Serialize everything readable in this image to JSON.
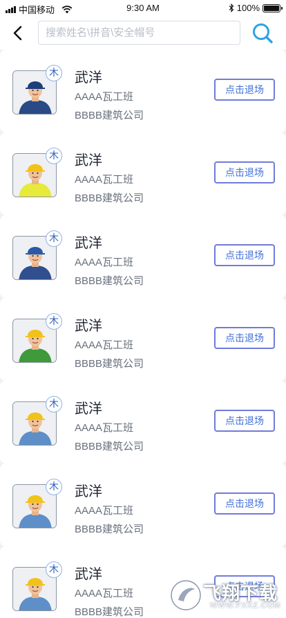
{
  "status_bar": {
    "carrier": "中国移动",
    "time": "9:30 AM",
    "battery": "100%"
  },
  "header": {
    "search_placeholder": "搜索姓名\\拼音\\安全帽号"
  },
  "workers": [
    {
      "name": "武洋",
      "team": "AAAA瓦工班",
      "company": "BBBB建筑公司",
      "badge": "木",
      "action": "点击退场",
      "helmet_color": "#1d3f7a",
      "vest_color": "#2a4a86"
    },
    {
      "name": "武洋",
      "team": "AAAA瓦工班",
      "company": "BBBB建筑公司",
      "badge": "木",
      "action": "点击退场",
      "helmet_color": "#f2c21a",
      "vest_color": "#e7ea3a"
    },
    {
      "name": "武洋",
      "team": "AAAA瓦工班",
      "company": "BBBB建筑公司",
      "badge": "木",
      "action": "点击退场",
      "helmet_color": "#2a5aa8",
      "vest_color": "#2f4f8f"
    },
    {
      "name": "武洋",
      "team": "AAAA瓦工班",
      "company": "BBBB建筑公司",
      "badge": "木",
      "action": "点击退场",
      "helmet_color": "#f2c21a",
      "vest_color": "#3f9a3a"
    },
    {
      "name": "武洋",
      "team": "AAAA瓦工班",
      "company": "BBBB建筑公司",
      "badge": "木",
      "action": "点击退场",
      "helmet_color": "#f2c21a",
      "vest_color": "#5e8fc8"
    },
    {
      "name": "武洋",
      "team": "AAAA瓦工班",
      "company": "BBBB建筑公司",
      "badge": "木",
      "action": "点击退场",
      "helmet_color": "#f2c21a",
      "vest_color": "#5e8fc8"
    },
    {
      "name": "武洋",
      "team": "AAAA瓦工班",
      "company": "BBBB建筑公司",
      "badge": "木",
      "action": "点击退场",
      "helmet_color": "#f2c21a",
      "vest_color": "#5e8fc8"
    }
  ],
  "watermark": {
    "text": "飞翔下载",
    "url": "WWW.FXXZ.COM"
  },
  "colors": {
    "accent": "#3f6fd8",
    "button_border": "#6f7bd9",
    "search_icon": "#2aa4e4"
  },
  "icons": [
    "signal-icon",
    "wifi-icon",
    "bluetooth-icon",
    "battery-icon",
    "back-arrow-icon",
    "search-icon"
  ]
}
